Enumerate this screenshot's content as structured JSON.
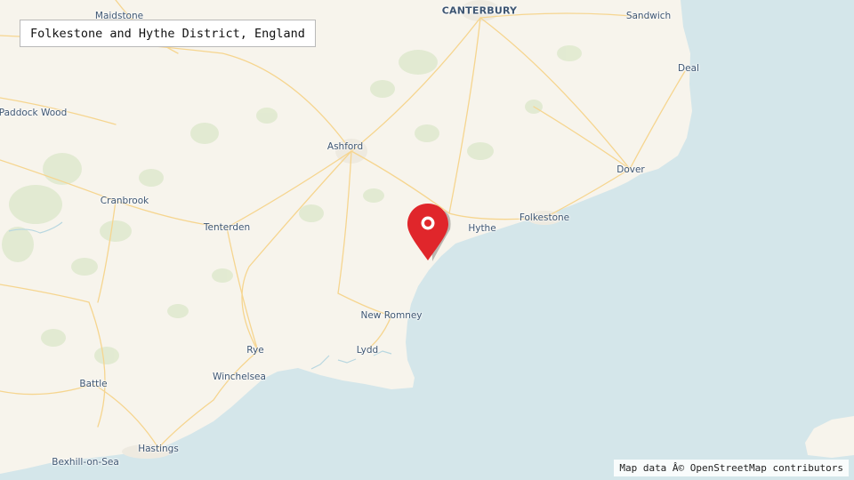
{
  "title": "Folkestone and Hythe District, England",
  "attribution": "Map data Â© OpenStreetMap contributors",
  "places": {
    "maidstone": "Maidstone",
    "canterbury": "CANTERBURY",
    "sandwich": "Sandwich",
    "deal": "Deal",
    "paddock_wood": "Paddock Wood",
    "ashford": "Ashford",
    "dover": "Dover",
    "cranbrook": "Cranbrook",
    "folkestone": "Folkestone",
    "hythe": "Hythe",
    "tenterden": "Tenterden",
    "new_romney": "New Romney",
    "rye": "Rye",
    "lydd": "Lydd",
    "winchelsea": "Winchelsea",
    "battle": "Battle",
    "hastings": "Hastings",
    "bexhill": "Bexhill-on-Sea"
  },
  "colors": {
    "land": "#f7f4ec",
    "sea": "#d4e6ea",
    "road": "#f6d58f",
    "marker": "#e0262b"
  },
  "marker": {
    "icon": "map-pin-icon"
  }
}
